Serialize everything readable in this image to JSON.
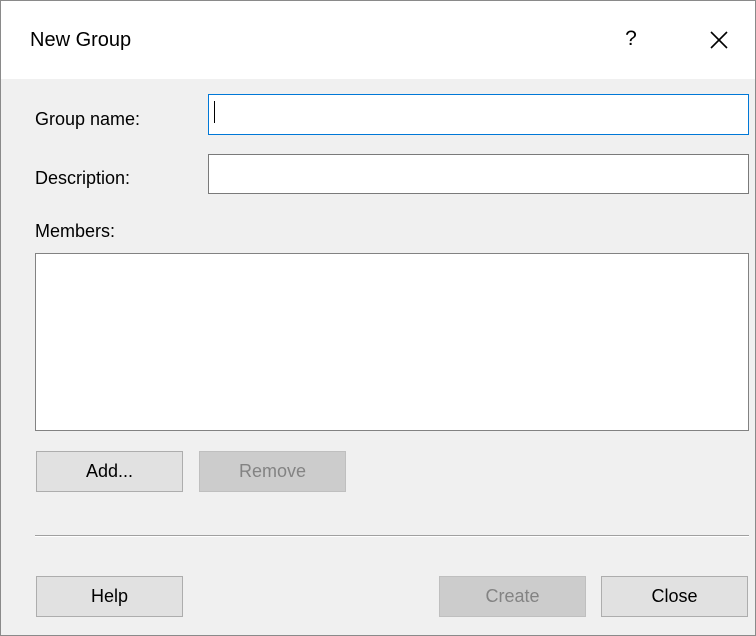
{
  "dialog": {
    "title": "New Group",
    "help_glyph": "?",
    "close_glyph": "close-icon"
  },
  "form": {
    "group_name_label": "Group name:",
    "group_name_value": "",
    "description_label": "Description:",
    "description_value": "",
    "members_label": "Members:",
    "members_items": []
  },
  "buttons": {
    "add_label": "Add...",
    "remove_label": "Remove",
    "help_label": "Help",
    "create_label": "Create",
    "close_label": "Close"
  },
  "state": {
    "remove_enabled": false,
    "create_enabled": false,
    "focused_field": "group_name"
  },
  "colors": {
    "focus_border": "#0078d7",
    "dialog_background": "#f0f0f0",
    "titlebar_background": "#ffffff",
    "disabled_text": "#838383"
  }
}
